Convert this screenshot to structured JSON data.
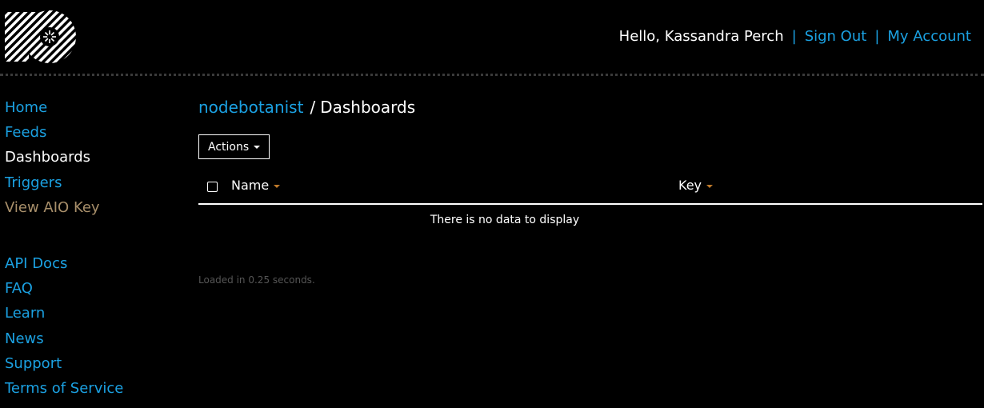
{
  "header": {
    "logo_name": "io-logo",
    "greeting": "Hello, Kassandra Perch",
    "separator": "|",
    "sign_out_label": "Sign Out",
    "my_account_label": "My Account"
  },
  "sidebar": {
    "items": [
      {
        "label": "Home"
      },
      {
        "label": "Feeds"
      },
      {
        "label": "Dashboards"
      },
      {
        "label": "Triggers"
      },
      {
        "label": "View AIO Key"
      }
    ],
    "secondary_items": [
      {
        "label": "API Docs"
      },
      {
        "label": "FAQ"
      },
      {
        "label": "Learn"
      },
      {
        "label": "News"
      },
      {
        "label": "Support"
      },
      {
        "label": "Terms of Service"
      }
    ]
  },
  "main": {
    "breadcrumb_user": "nodebotanist",
    "breadcrumb_sep": "/",
    "breadcrumb_page": "Dashboards",
    "actions_label": "Actions",
    "columns": {
      "name": "Name",
      "key": "Key"
    },
    "empty_text": "There is no data to display",
    "loaded_text": "Loaded in 0.25 seconds."
  },
  "colors": {
    "link": "#1ba1e2",
    "key_link": "#a88f6a",
    "sort_caret": "#c07a2a",
    "background": "#000000"
  }
}
